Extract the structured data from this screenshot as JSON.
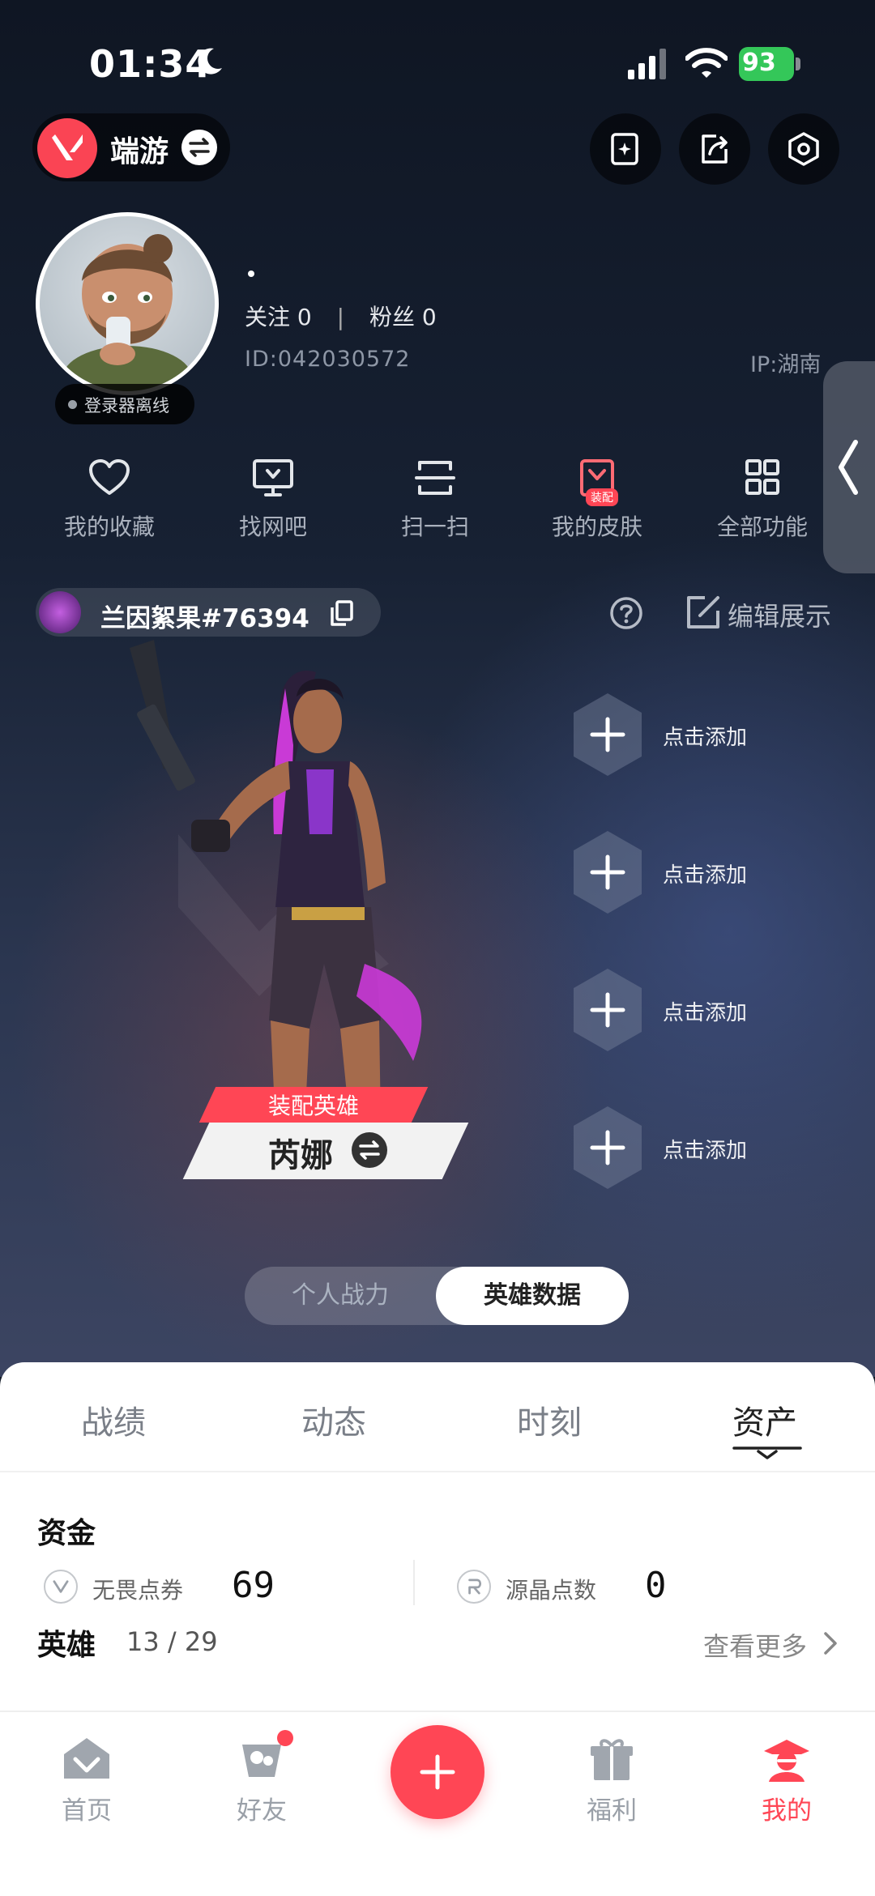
{
  "status_bar": {
    "time": "01:34",
    "battery": "93"
  },
  "header": {
    "game_name": "端游"
  },
  "profile": {
    "follow_label": "关注",
    "follow_count": "0",
    "fans_label": "粉丝",
    "fans_count": "0",
    "id_text": "ID:042030572",
    "ip_text": "IP:湖南",
    "offline_badge": "登录器离线"
  },
  "quick_actions": [
    {
      "label": "我的收藏",
      "icon": "heart-icon"
    },
    {
      "label": "找网吧",
      "icon": "monitor-icon"
    },
    {
      "label": "扫一扫",
      "icon": "scan-icon"
    },
    {
      "label": "我的皮肤",
      "icon": "skin-icon",
      "tag": "装配"
    },
    {
      "label": "全部功能",
      "icon": "grid-icon"
    }
  ],
  "player": {
    "name": "兰因絮果#76394",
    "edit_label": "编辑展示"
  },
  "hero": {
    "tag": "装配英雄",
    "name": "芮娜"
  },
  "add_slots": [
    "点击添加",
    "点击添加",
    "点击添加",
    "点击添加"
  ],
  "segment": {
    "off": "个人战力",
    "on": "英雄数据"
  },
  "tabs": [
    "战绩",
    "动态",
    "时刻",
    "资产"
  ],
  "assets": {
    "title": "资金",
    "currencies": [
      {
        "label": "无畏点券",
        "value": "69"
      },
      {
        "label": "源晶点数",
        "value": "0"
      }
    ],
    "heroes_title": "英雄",
    "heroes_count": "13 / 29",
    "see_more": "查看更多"
  },
  "bottom_nav": [
    {
      "label": "首页",
      "active": false
    },
    {
      "label": "好友",
      "active": false,
      "badge": true
    },
    {
      "label": "福利",
      "active": false
    },
    {
      "label": "我的",
      "active": true
    }
  ],
  "colors": {
    "accent": "#ff4655",
    "battery": "#34c759"
  }
}
